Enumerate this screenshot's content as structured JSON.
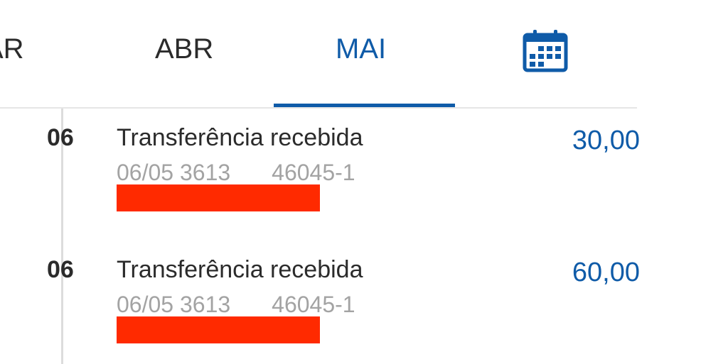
{
  "tabs": [
    {
      "label": "AR",
      "active": false
    },
    {
      "label": "ABR",
      "active": false
    },
    {
      "label": "MAI",
      "active": true
    }
  ],
  "calendar_icon": "calendar-icon",
  "colors": {
    "accent": "#0f5ba8",
    "text": "#2b2b2b",
    "muted": "#a3a3a3",
    "redaction": "#ff2a00"
  },
  "entries": [
    {
      "day": "06",
      "title": "Transferência recebida",
      "date_code": "06/05 3613",
      "reference": "46045-1",
      "amount": "30,00"
    },
    {
      "day": "06",
      "title": "Transferência recebida",
      "date_code": "06/05 3613",
      "reference": "46045-1",
      "amount": "60,00"
    }
  ]
}
